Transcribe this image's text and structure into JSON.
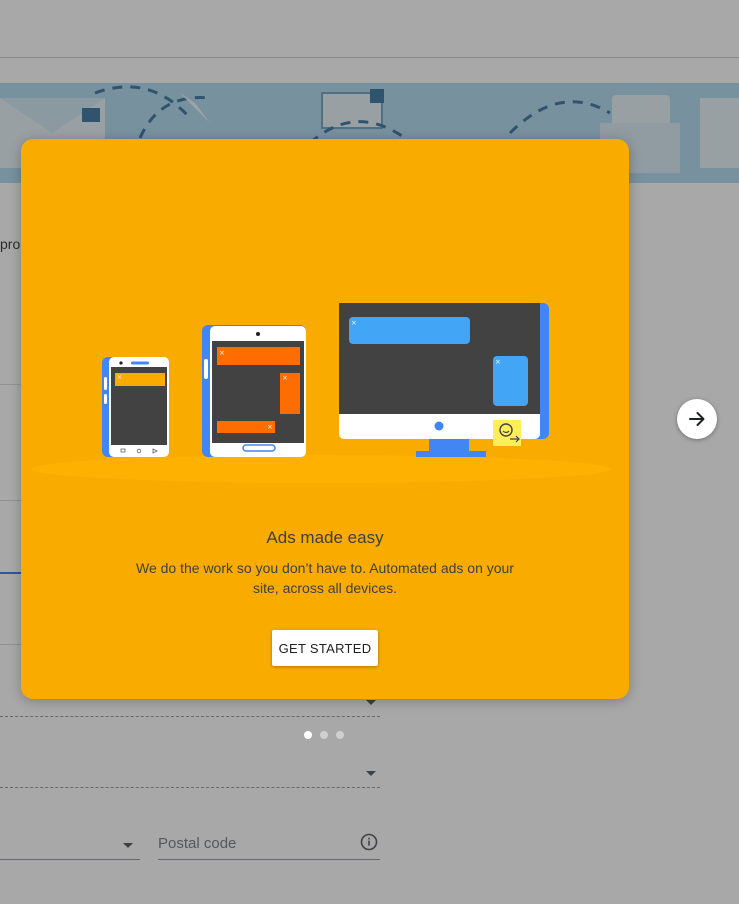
{
  "background_page": {
    "truncated_label": "pro",
    "postal_code_placeholder": "Postal code",
    "info_icon": "info-icon",
    "dropdown_icon": "dropdown-arrow-icon"
  },
  "onboarding": {
    "slide_title": "Ads made easy",
    "slide_description": "We do the work so you don’t have to. Automated ads on your site, across all devices.",
    "cta_label": "GET STARTED",
    "next_icon": "arrow-right-icon",
    "pagination": {
      "current": 1,
      "total": 3
    }
  },
  "colors": {
    "modal_background": "#f9ab00",
    "device_blue": "#4285f4",
    "ad_orange": "#ff6d00",
    "ad_yellow": "#f9ab00",
    "ad_light_blue": "#42a5f5",
    "screen_dark": "#424242",
    "scrim": "#000000"
  }
}
